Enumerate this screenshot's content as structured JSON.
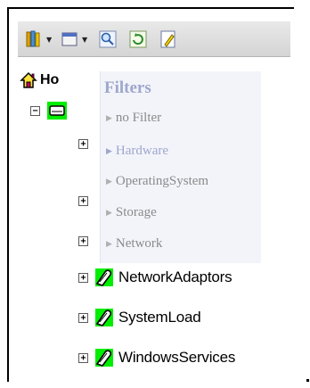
{
  "toolbar": {
    "buttons": [
      {
        "icon": "library-books-icon",
        "has_dropdown": true
      },
      {
        "icon": "window-layout-icon",
        "has_dropdown": true
      },
      {
        "icon": "search-icon",
        "has_dropdown": false
      },
      {
        "icon": "refresh-icon",
        "has_dropdown": false
      },
      {
        "icon": "edit-icon",
        "has_dropdown": false
      }
    ]
  },
  "tree": {
    "home_label": "Ho",
    "collapse_symbol": "−",
    "expand_symbol": "+",
    "nodes": [
      {
        "label": ""
      },
      {
        "label": ""
      },
      {
        "label": ""
      },
      {
        "label": "NetworkAdaptors"
      },
      {
        "label": "SystemLoad"
      },
      {
        "label": "WindowsServices"
      }
    ]
  },
  "filters": {
    "title": "Filters",
    "items": [
      {
        "label": "no Filter",
        "active": false
      },
      {
        "label": "Hardware",
        "active": true
      },
      {
        "label": "OperatingSystem",
        "active": false
      },
      {
        "label": "Storage",
        "active": false
      },
      {
        "label": "Network",
        "active": false
      }
    ]
  },
  "colors": {
    "highlight_green": "#00ee00",
    "filter_title": "#9ea7cc",
    "filter_text": "#8a8a8a"
  }
}
